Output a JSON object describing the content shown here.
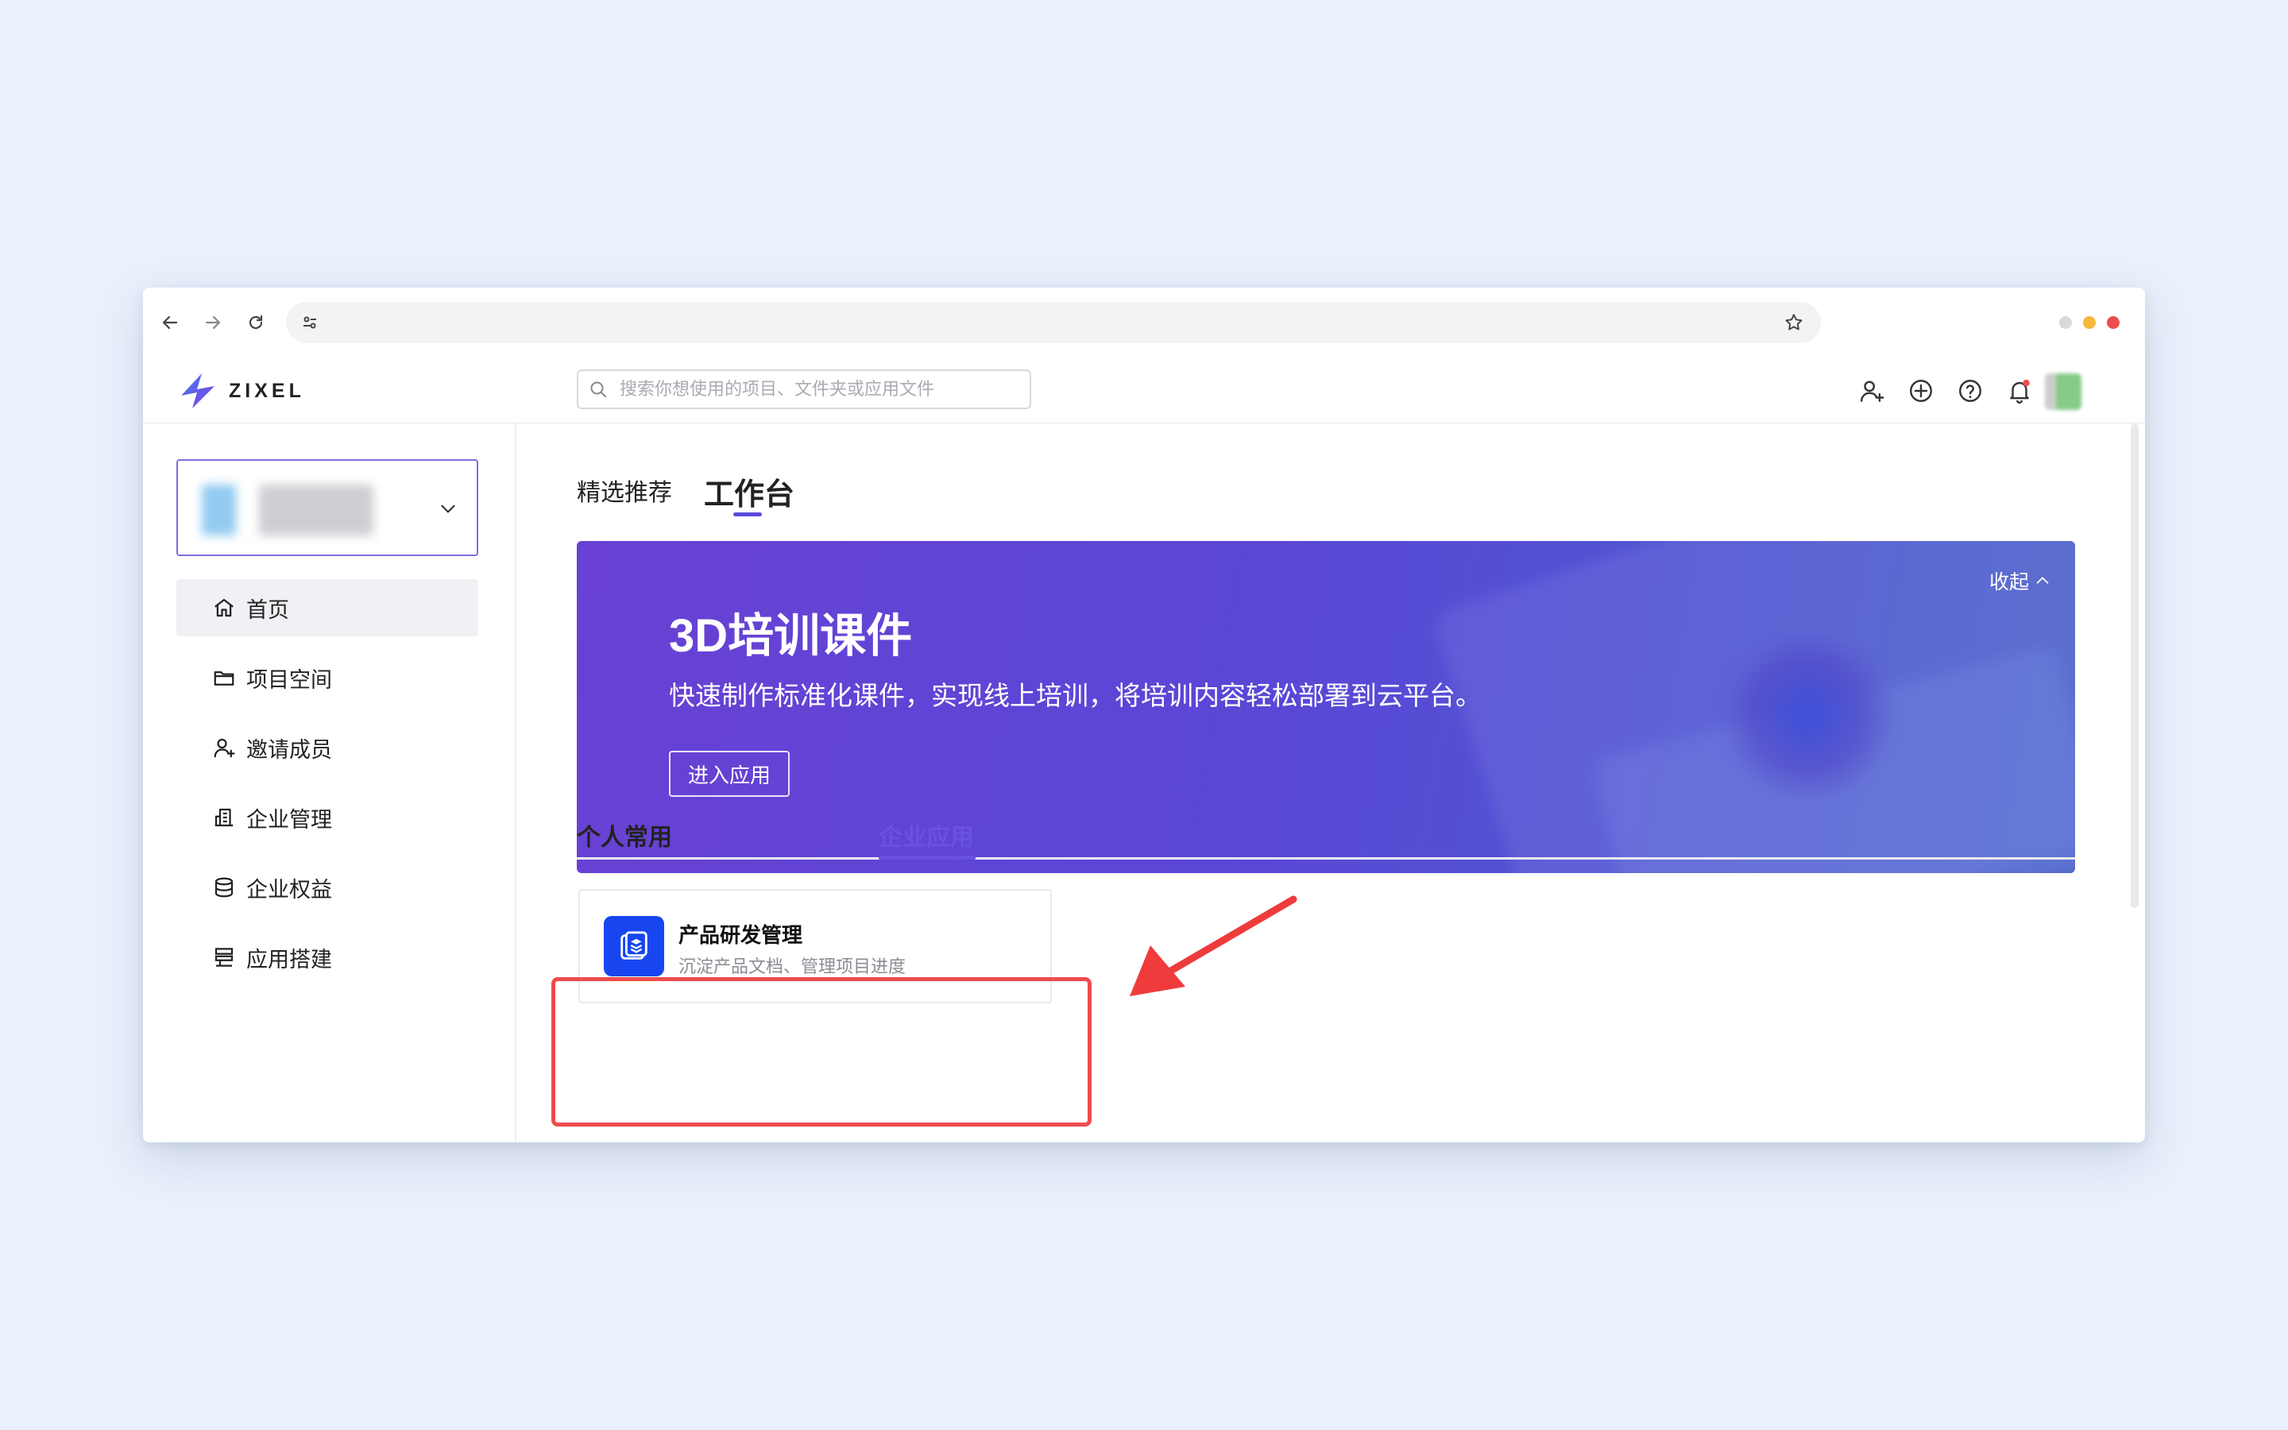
{
  "browser": {
    "url": "",
    "traffic_colors": [
      "#d9d9d9",
      "#f5b83d",
      "#ee4d4d"
    ]
  },
  "header": {
    "logo_text": "ZIXEL",
    "search_placeholder": "搜索你想使用的项目、文件夹或应用文件",
    "icons": [
      "add-user-icon",
      "plus-circle-icon",
      "help-icon",
      "bell-icon"
    ],
    "notification_dot_color": "#ef4b4b"
  },
  "sidebar": {
    "items": [
      {
        "label": "首页",
        "icon": "home-icon",
        "active": true
      },
      {
        "label": "项目空间",
        "icon": "folder-icon",
        "active": false
      },
      {
        "label": "邀请成员",
        "icon": "add-user-icon",
        "active": false
      },
      {
        "label": "企业管理",
        "icon": "building-icon",
        "active": false
      },
      {
        "label": "企业权益",
        "icon": "database-icon",
        "active": false
      },
      {
        "label": "应用搭建",
        "icon": "layout-icon",
        "active": false
      }
    ]
  },
  "main": {
    "tabs": [
      {
        "label": "精选推荐",
        "active": false
      },
      {
        "label": "工作台",
        "active": true
      }
    ],
    "banner": {
      "title": "3D培训课件",
      "subtitle": "快速制作标准化课件，实现线上培训，将培训内容轻松部署到云平台。",
      "button": "进入应用",
      "collapse": "收起"
    },
    "sub_tabs": [
      {
        "label": "个人常用",
        "active": false
      },
      {
        "label": "企业应用",
        "active": true
      }
    ],
    "app_card": {
      "title": "产品研发管理",
      "description": "沉淀产品文档、管理项目进度",
      "icon_color": "#1746f0"
    }
  },
  "annotation": {
    "highlight_color": "#ef4b4b"
  }
}
